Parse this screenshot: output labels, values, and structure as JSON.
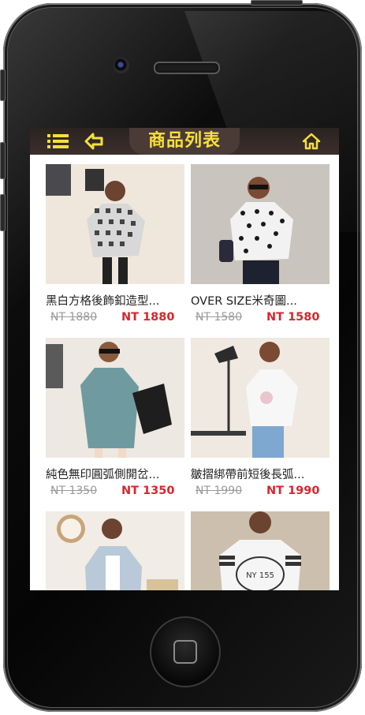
{
  "header": {
    "title": "商品列表",
    "menu_icon": "list-icon",
    "back_icon": "back-arrow-icon",
    "home_icon": "home-icon",
    "accent_color": "#f6e03a"
  },
  "products": [
    {
      "name": "黑白方格後飾釦造型...",
      "original_price": "NT 1880",
      "sale_price": "NT 1880"
    },
    {
      "name": "OVER SIZE米奇圖...",
      "original_price": "NT 1580",
      "sale_price": "NT 1580"
    },
    {
      "name": "純色無印圓弧側開岔...",
      "original_price": "NT 1350",
      "sale_price": "NT 1350"
    },
    {
      "name": "皺摺綁帶前短後長弧...",
      "original_price": "NT 1990",
      "sale_price": "NT 1990"
    },
    {
      "name": "",
      "original_price": "",
      "sale_price": ""
    },
    {
      "name": "",
      "original_price": "",
      "sale_price": ""
    }
  ]
}
